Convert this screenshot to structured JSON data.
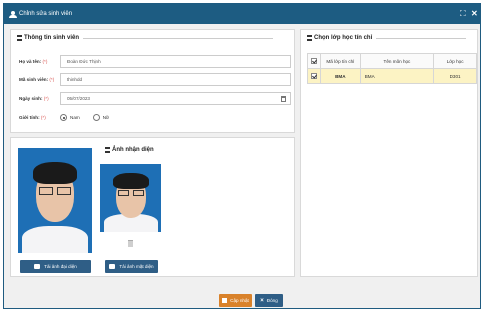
{
  "window": {
    "title": "Chỉnh sửa sinh viên",
    "maximize_glyph": "⛶",
    "close_glyph": "✕"
  },
  "student_info": {
    "title": "Thông tin sinh viên",
    "fields": {
      "name_label": "Họ và tên:",
      "name_value": "Đoàn Đức Thịnh",
      "id_label": "Mã sinh viên:",
      "id_value": "thinhdd",
      "dob_label": "Ngày sinh:",
      "dob_value": "05/07/2023",
      "gender_label": "Giới tính:",
      "required_mark": "(*)"
    },
    "gender_options": [
      {
        "label": "Nam",
        "selected": true
      },
      {
        "label": "Nữ",
        "selected": false
      }
    ]
  },
  "photos": {
    "recognition_title": "Ảnh nhận diện",
    "upload_profile_label": "Tải ảnh đại diện",
    "upload_face_label": "Tải ảnh mặt diện"
  },
  "class_select": {
    "title": "Chọn lớp học tín chỉ",
    "columns": [
      "",
      "Mã lớp tín chỉ",
      "Tên môn học",
      "Lớp học"
    ],
    "rows": [
      {
        "checked": true,
        "code": "BMA",
        "subject": "BMA",
        "class": "D301"
      }
    ]
  },
  "footer": {
    "update_label": "Cập nhật",
    "close_label": "Đóng"
  },
  "colors": {
    "titlebar": "#1d5c82",
    "update_button": "#d9822b",
    "close_button": "#2f5e86",
    "selected_row": "#fcf3c4"
  }
}
